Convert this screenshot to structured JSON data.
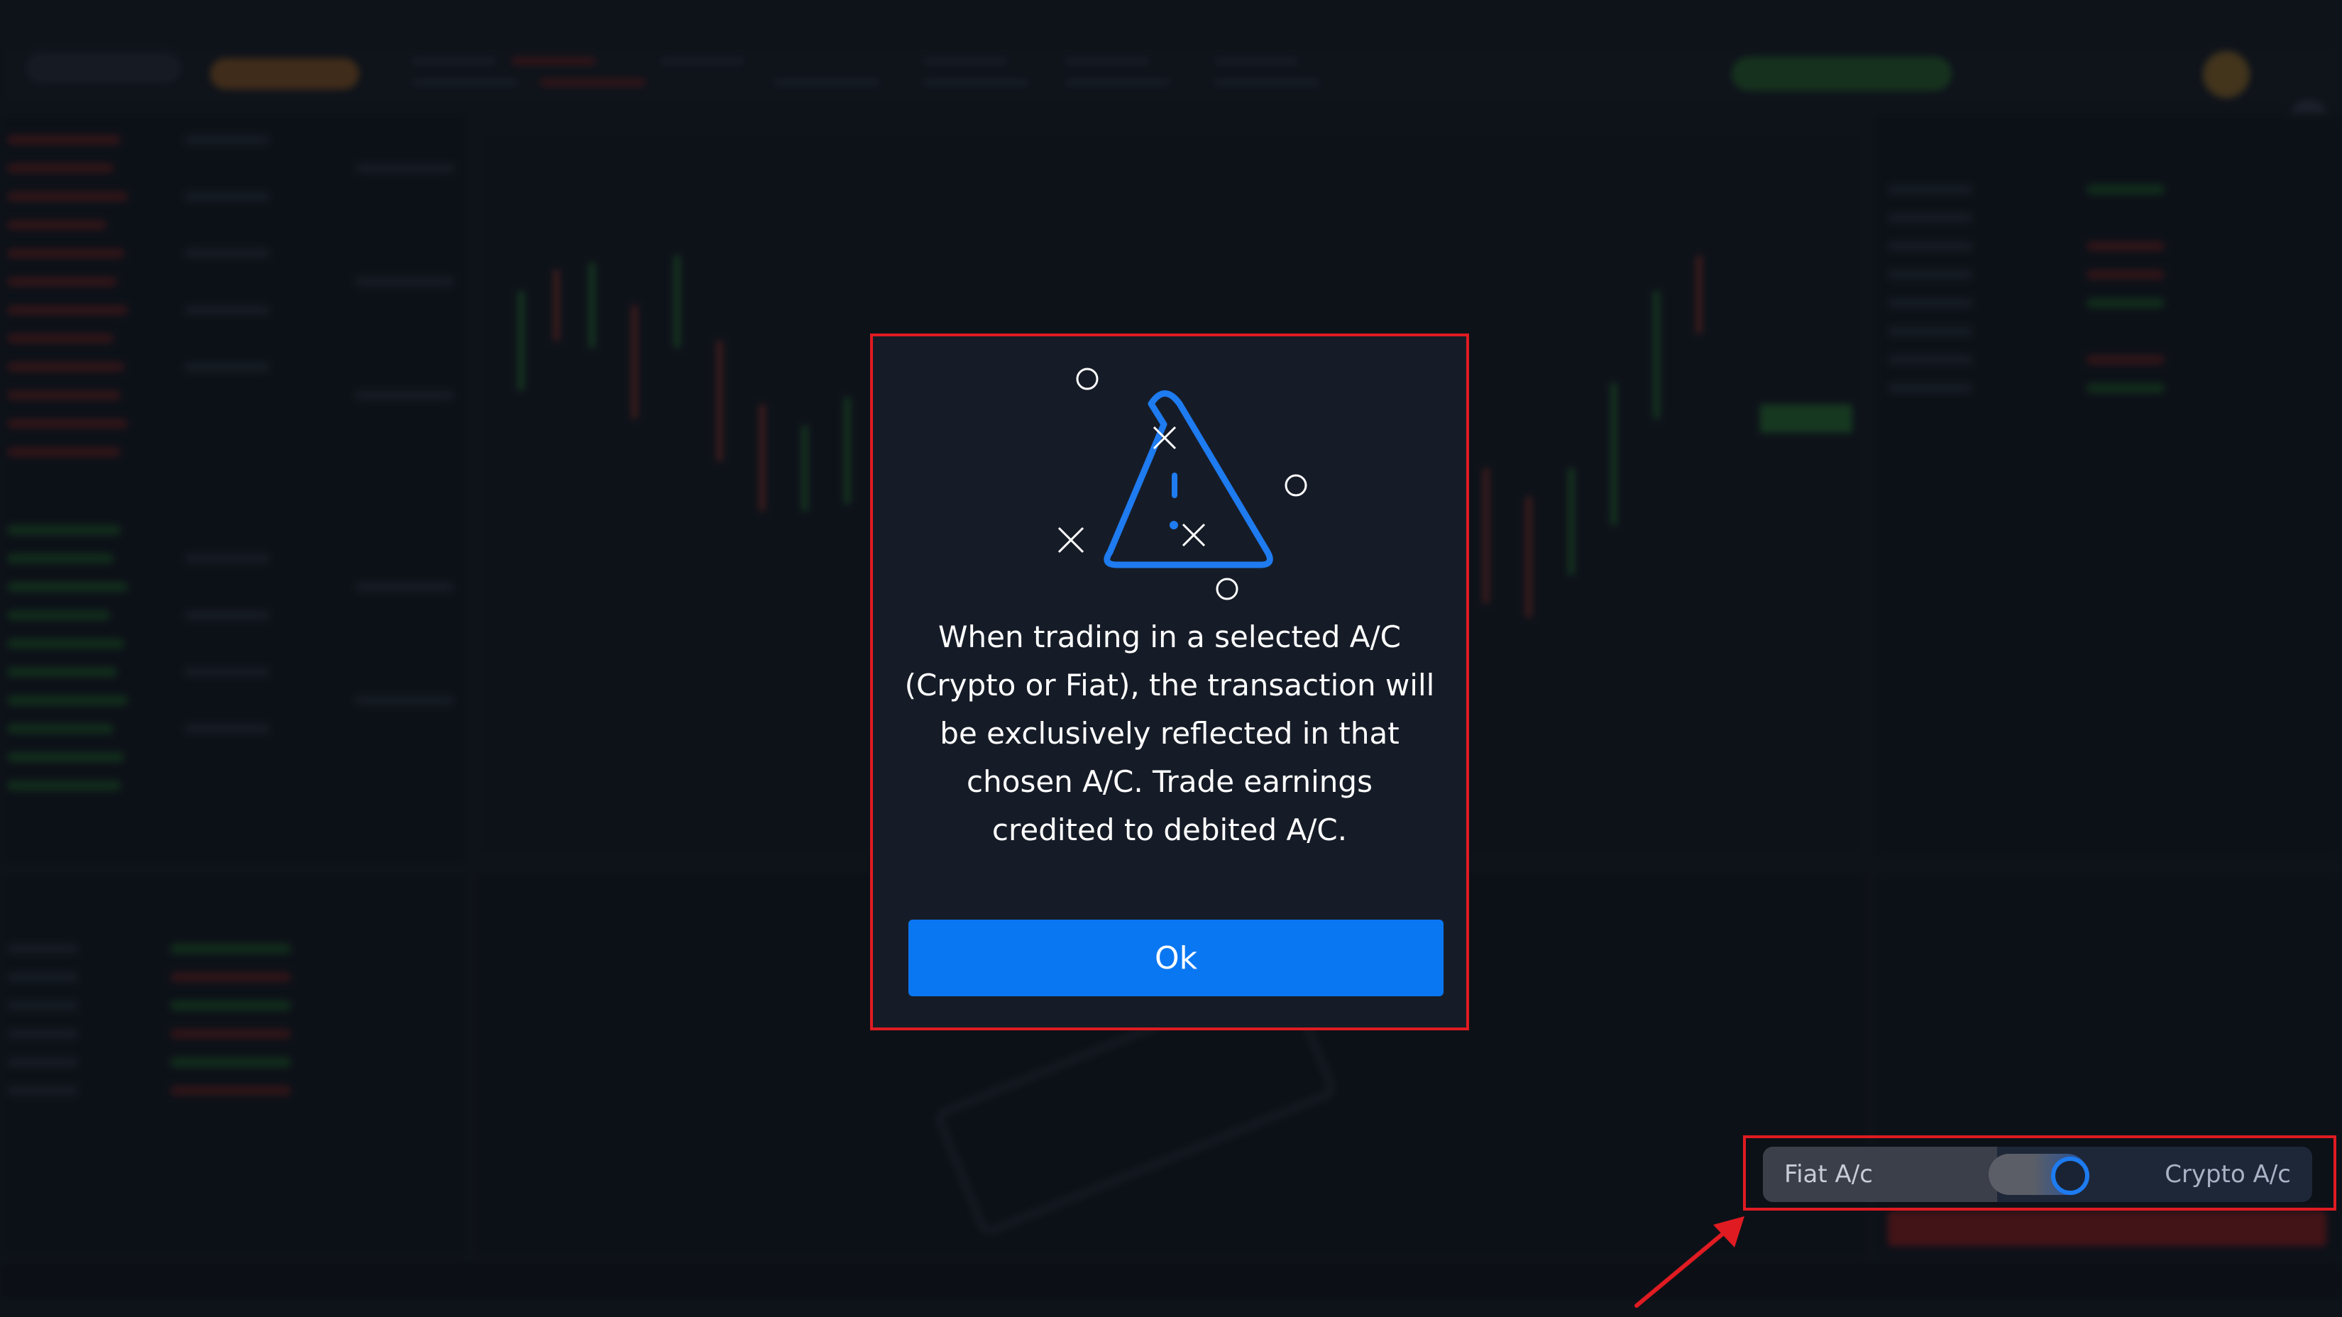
{
  "colors": {
    "highlight_border": "#e01b22",
    "modal_background": "#161c27",
    "ok_button": "#0a77f2",
    "toggle_accent": "#1e7bf0"
  },
  "modal": {
    "icon": "warning-triangle-icon",
    "message": "When trading in a selected A/C (Crypto or Fiat), the transaction will be exclusively reflected in that chosen A/C. Trade earnings credited to debited A/C.",
    "ok_label": "Ok"
  },
  "account_toggle": {
    "left_label": "Fiat A/c",
    "right_label": "Crypto A/c",
    "selected": "Crypto A/c"
  }
}
